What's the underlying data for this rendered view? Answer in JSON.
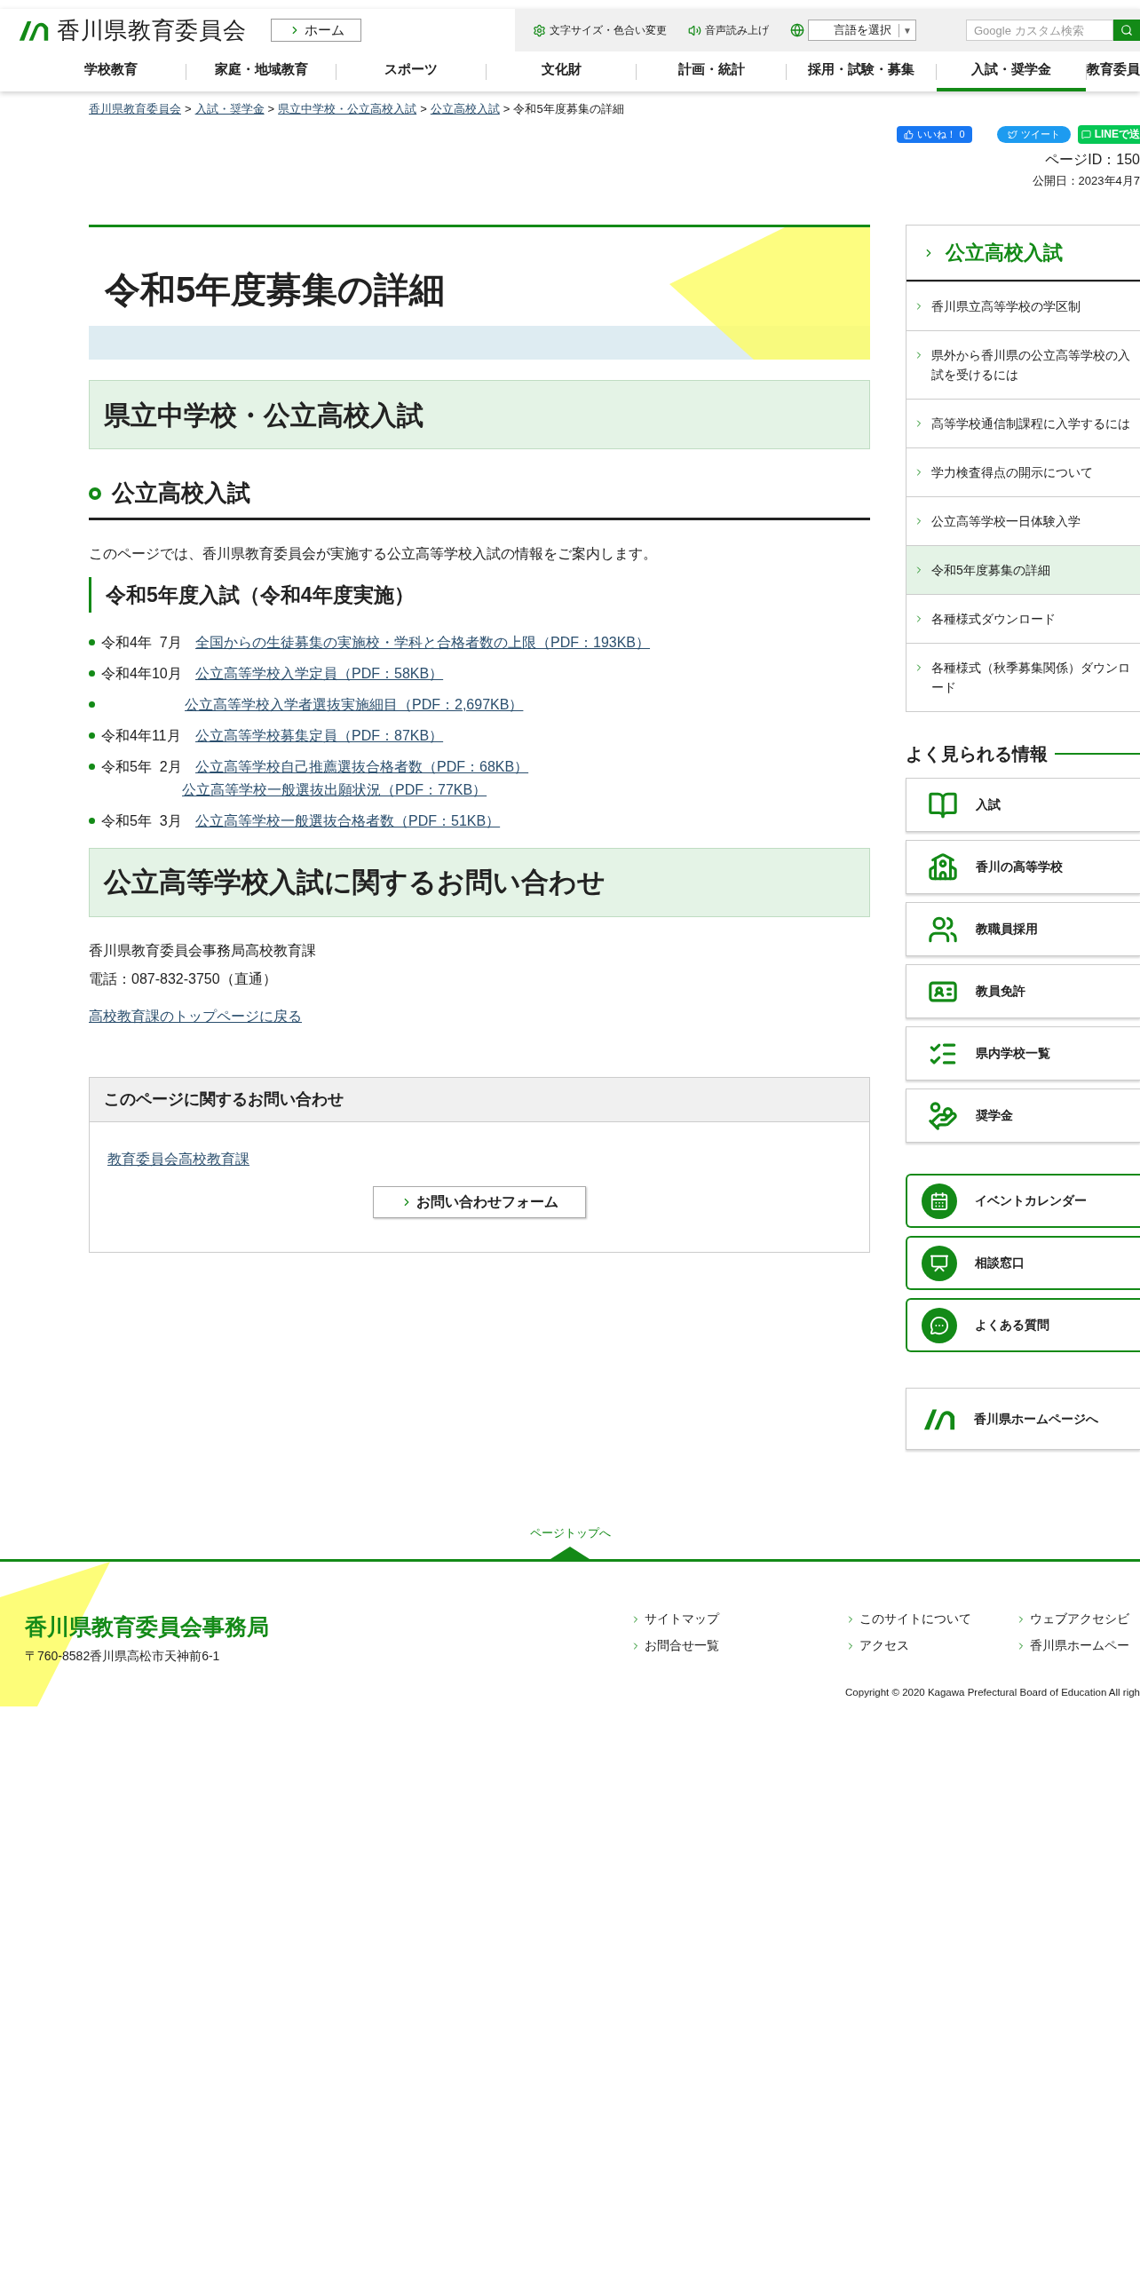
{
  "header": {
    "logo_text": "香川県教育委員会",
    "home_button": "ホーム",
    "tools": [
      {
        "kind": "settings",
        "label": "文字サイズ・色合い変更"
      },
      {
        "kind": "speaker",
        "label": "音声読み上げ"
      }
    ],
    "language_select": "言語を選択",
    "dropdown_arrow": "▼",
    "search": {
      "placeholder": "Google カスタム検索"
    }
  },
  "nav": [
    {
      "label": "学校教育",
      "selected": false
    },
    {
      "label": "家庭・地域教育",
      "selected": false
    },
    {
      "label": "スポーツ",
      "selected": false
    },
    {
      "label": "文化財",
      "selected": false
    },
    {
      "label": "計画・統計",
      "selected": false
    },
    {
      "label": "採用・試験・募集",
      "selected": false
    },
    {
      "label": "入試・奨学金",
      "selected": true
    },
    {
      "label": "教育委員",
      "selected": false
    }
  ],
  "breadcrumb": [
    {
      "label": "香川県教育委員会",
      "kind": "link"
    },
    {
      "separator": ">",
      "label": "入試・奨学金",
      "kind": "link"
    },
    {
      "separator": ">",
      "label": "県立中学校・公立高校入試",
      "kind": "link"
    },
    {
      "separator": ">",
      "label": "公立高校入試",
      "kind": "link"
    },
    {
      "separator": ">",
      "label": "令和5年度募集の詳細",
      "kind": "current"
    }
  ],
  "social": {
    "like": "いいね！",
    "like_count": "0",
    "tweet": "ツイート",
    "line": "LINEで送"
  },
  "page_id": "ページID：150",
  "published": "公開日：2023年4月7",
  "main": {
    "title": "令和5年度募集の詳細",
    "section_heading": "県立中学校・公立高校入試",
    "subheading": "公立高校入試",
    "intro": "このページでは、香川県教育委員会が実施する公立高等学校入試の情報をご案内します。",
    "year_heading": "令和5年度入試（令和4年度実施）",
    "items": [
      {
        "date": "令和4年  7月",
        "links": [
          "全国からの生徒募集の実施校・学科と合格者数の上限（PDF：193KB）"
        ]
      },
      {
        "date": "令和4年10月",
        "links": [
          "公立高等学校入学定員（PDF：58KB）"
        ]
      },
      {
        "links": [
          "公立高等学校入学者選抜実施細目（PDF：2,697KB）"
        ]
      },
      {
        "date": "令和4年11月",
        "links": [
          "公立高等学校募集定員（PDF：87KB）"
        ]
      },
      {
        "date": "令和5年  2月",
        "links": [
          "公立高等学校自己推薦選抜合格者数（PDF：68KB）",
          "公立高等学校一般選抜出願状況（PDF：77KB）"
        ]
      },
      {
        "date": "令和5年  3月",
        "links": [
          "公立高等学校一般選抜合格者数（PDF：51KB）"
        ]
      }
    ],
    "inquiry_heading": "公立高等学校入試に関するお問い合わせ",
    "contact_lines": [
      "香川県教育委員会事務局高校教育課",
      "電話：087-832-3750（直通）"
    ],
    "back_link": "高校教育課のトップページに戻る",
    "contact_box": {
      "title": "このページに関するお問い合わせ",
      "link": "教育委員会高校教育課",
      "button": "お問い合わせフォーム"
    }
  },
  "sidebar": {
    "menu": {
      "title": "公立高校入試",
      "items": [
        {
          "label": "香川県立高等学校の学区制",
          "selected": false
        },
        {
          "label": "県外から香川県の公立高等学校の入試を受けるには",
          "selected": false
        },
        {
          "label": "高等学校通信制課程に入学するには",
          "selected": false
        },
        {
          "label": "学力検査得点の開示について",
          "selected": false
        },
        {
          "label": "公立高等学校一日体験入学",
          "selected": false
        },
        {
          "label": "令和5年度募集の詳細",
          "selected": true
        },
        {
          "label": "各種様式ダウンロード",
          "selected": false
        },
        {
          "label": "各種様式（秋季募集関係）ダウンロード",
          "selected": false
        }
      ]
    },
    "popular": {
      "title": "よく見られる情報",
      "items": [
        {
          "label": "入試"
        },
        {
          "label": "香川の高等学校"
        },
        {
          "label": "教職員採用"
        },
        {
          "label": "教員免許"
        },
        {
          "label": "県内学校一覧"
        },
        {
          "label": "奨学金"
        }
      ]
    },
    "quick": [
      {
        "label": "イベントカレンダー"
      },
      {
        "label": "相談窓口"
      },
      {
        "label": "よくある質問"
      }
    ],
    "home_link": "香川県ホームページへ"
  },
  "footer": {
    "page_top": "ページトップへ",
    "org": "香川県教育委員会事務局",
    "address": "〒760-8582香川県高松市天神前6-1",
    "links": [
      "サイトマップ",
      "このサイトについて",
      "ウェブアクセシビ",
      "お問合せ一覧",
      "アクセス",
      "香川県ホームペー"
    ],
    "copyright": "Copyright © 2020 Kagawa Prefectural Board of Education All righ"
  }
}
